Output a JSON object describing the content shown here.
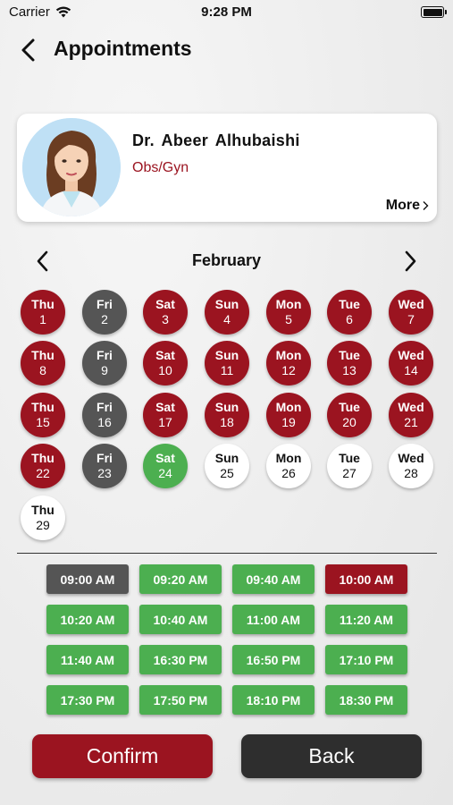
{
  "status_bar": {
    "carrier": "Carrier",
    "time": "9:28 PM"
  },
  "nav": {
    "title": "Appointments",
    "back_icon": "chevron-left-icon"
  },
  "doctor": {
    "name": "Dr. Abeer  Alhubaishi",
    "specialty": "Obs/Gyn",
    "more_label": "More",
    "avatar": "doctor-avatar"
  },
  "calendar": {
    "month": "February",
    "days": [
      {
        "name": "Thu",
        "num": "1",
        "state": "red"
      },
      {
        "name": "Fri",
        "num": "2",
        "state": "gray"
      },
      {
        "name": "Sat",
        "num": "3",
        "state": "red"
      },
      {
        "name": "Sun",
        "num": "4",
        "state": "red"
      },
      {
        "name": "Mon",
        "num": "5",
        "state": "red"
      },
      {
        "name": "Tue",
        "num": "6",
        "state": "red"
      },
      {
        "name": "Wed",
        "num": "7",
        "state": "red"
      },
      {
        "name": "Thu",
        "num": "8",
        "state": "red"
      },
      {
        "name": "Fri",
        "num": "9",
        "state": "gray"
      },
      {
        "name": "Sat",
        "num": "10",
        "state": "red"
      },
      {
        "name": "Sun",
        "num": "11",
        "state": "red"
      },
      {
        "name": "Mon",
        "num": "12",
        "state": "red"
      },
      {
        "name": "Tue",
        "num": "13",
        "state": "red"
      },
      {
        "name": "Wed",
        "num": "14",
        "state": "red"
      },
      {
        "name": "Thu",
        "num": "15",
        "state": "red"
      },
      {
        "name": "Fri",
        "num": "16",
        "state": "gray"
      },
      {
        "name": "Sat",
        "num": "17",
        "state": "red"
      },
      {
        "name": "Sun",
        "num": "18",
        "state": "red"
      },
      {
        "name": "Mon",
        "num": "19",
        "state": "red"
      },
      {
        "name": "Tue",
        "num": "20",
        "state": "red"
      },
      {
        "name": "Wed",
        "num": "21",
        "state": "red"
      },
      {
        "name": "Thu",
        "num": "22",
        "state": "red"
      },
      {
        "name": "Fri",
        "num": "23",
        "state": "gray"
      },
      {
        "name": "Sat",
        "num": "24",
        "state": "green"
      },
      {
        "name": "Sun",
        "num": "25",
        "state": "white"
      },
      {
        "name": "Mon",
        "num": "26",
        "state": "white"
      },
      {
        "name": "Tue",
        "num": "27",
        "state": "white"
      },
      {
        "name": "Wed",
        "num": "28",
        "state": "white"
      },
      {
        "name": "Thu",
        "num": "29",
        "state": "white"
      }
    ]
  },
  "time_slots": [
    {
      "label": "09:00 AM",
      "state": "gray"
    },
    {
      "label": "09:20 AM",
      "state": "green"
    },
    {
      "label": "09:40 AM",
      "state": "green"
    },
    {
      "label": "10:00 AM",
      "state": "red"
    },
    {
      "label": "10:20 AM",
      "state": "green"
    },
    {
      "label": "10:40 AM",
      "state": "green"
    },
    {
      "label": "11:00 AM",
      "state": "green"
    },
    {
      "label": "11:20 AM",
      "state": "green"
    },
    {
      "label": "11:40 AM",
      "state": "green"
    },
    {
      "label": "16:30 PM",
      "state": "green"
    },
    {
      "label": "16:50 PM",
      "state": "green"
    },
    {
      "label": "17:10 PM",
      "state": "green"
    },
    {
      "label": "17:30 PM",
      "state": "green"
    },
    {
      "label": "17:50 PM",
      "state": "green"
    },
    {
      "label": "18:10 PM",
      "state": "green"
    },
    {
      "label": "18:30 PM",
      "state": "green"
    }
  ],
  "actions": {
    "confirm_label": "Confirm",
    "back_label": "Back"
  },
  "colors": {
    "brand_red": "#9b1420",
    "available_green": "#4caf50",
    "unavailable_gray": "#555555",
    "back_dark": "#2e2e2e"
  }
}
